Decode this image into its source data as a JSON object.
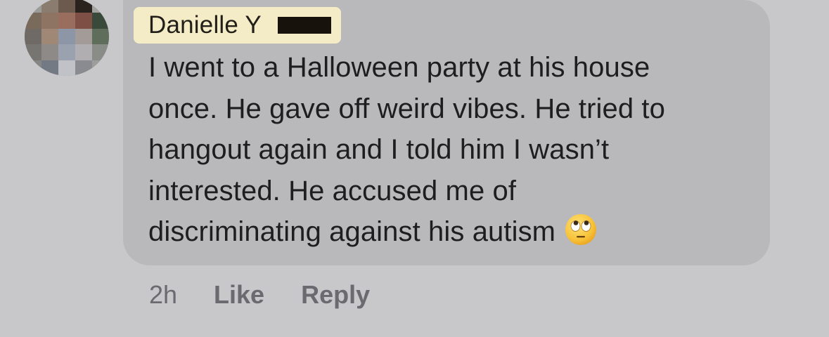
{
  "comment": {
    "author": "Danielle Y",
    "lines": [
      "I went to a Halloween party at his house",
      "once. He gave off weird vibes. He tried to",
      "hangout again and I told him I wasn’t",
      "interested. He accused me of",
      "discriminating against his autism"
    ],
    "emoji": "face-with-rolling-eyes",
    "timestamp": "2h",
    "like_label": "Like",
    "reply_label": "Reply"
  },
  "colors": {
    "background": "#c8c8ca",
    "bubble": "#b9b9bb",
    "author_highlight": "#f4ecc6",
    "text": "#1e1e20",
    "meta": "#6a6a70"
  }
}
